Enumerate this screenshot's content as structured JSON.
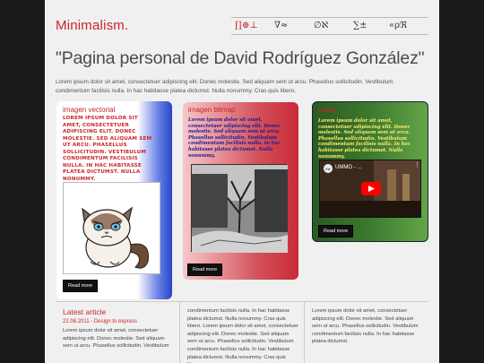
{
  "header": {
    "logo": "Minimalism.",
    "nav": [
      "∏⊕⊥",
      "∇≈",
      "∅ℵ",
      "∑±",
      "«ρℜ"
    ]
  },
  "title": "\"Pagina personal de David Rodríguez González\"",
  "intro": "Lorem ipsum dolor sit amet, consectetuer adipiscing elit. Donec molestie. Sed aliquam sem ut arcu. Phasellus sollicitudin. Vestibulum condimentum facilisis nulla. In hac habitasse platea dictumst. Nulla nonummy. Cras quis libero.",
  "cards": [
    {
      "title": "imagen vectorial",
      "text": "Lorem ipsum dolor sit amet, consectetuer adipiscing elit. Donec molestie. Sed aliquam sem ut arcu. Phasellus sollicitudin. Vestibulum condimentum facilisis nulla. In hac habitasse platea dictumst. Nulla nonummy.",
      "image": "grumpy-cat-cartoon",
      "button": "Read more"
    },
    {
      "title": "imagen bitmap",
      "text": "Lorem ipsum dolor sit amet, consectetuer adipiscing elit. Donec molestie. Sed aliquam sem ut arcu. Phasellus sollicitudin. Vestibulum condimentum facilisis nulla. In hac habitasse platea dictumst. Nulla nonummy.",
      "image": "black-and-white-park-photo",
      "button": "Read more"
    },
    {
      "title": "video",
      "text": "Lorem ipsum dolor sit amet, consectetuer adipiscing elit. Donec molestie. Sed aliquam sem ut arcu. Phasellus sollicitudin. Vestibulum condimentum facilisis nulla. In hac habitasse platea dictumst. Nulla nonummy.",
      "video_title": "UMMO - ...",
      "button": "Read more"
    }
  ],
  "footer": {
    "latest_title": "Latest article",
    "latest_date": "22.08.2011 - Design to express",
    "latest_text": "Lorem ipsum dolor sit amet, consectetuer adipiscing elit. Donec molestie. Sed aliquam sem ut arcu. Phasellus sollicitudin. Vestibulum",
    "col2_text": "condimentum facilisis nulla. In hac habitasse platea dictumst. Nulla nonummy. Cras quis libero. Lorem ipsum dolor sit amet, consectetuer adipiscing elit. Donec molestie. Sed aliquam sem ut arcu. Phasellus sollicitudin. Vestibulum condimentum facilisis nulla. In hac habitasse platea dictumst. Nulla nonummy. Cras quis libero.",
    "col3_text": "Lorem ipsum dolor sit amet, consectetuer adipiscing elit. Donec molestie. Sed aliquam sem ut arcu. Phasellus sollicitudin. Vestibulum condimentum facilisis nulla. In hac habitasse platea dictumst."
  },
  "colors": {
    "accent": "#c8262b",
    "youtube": "#ff0000"
  }
}
